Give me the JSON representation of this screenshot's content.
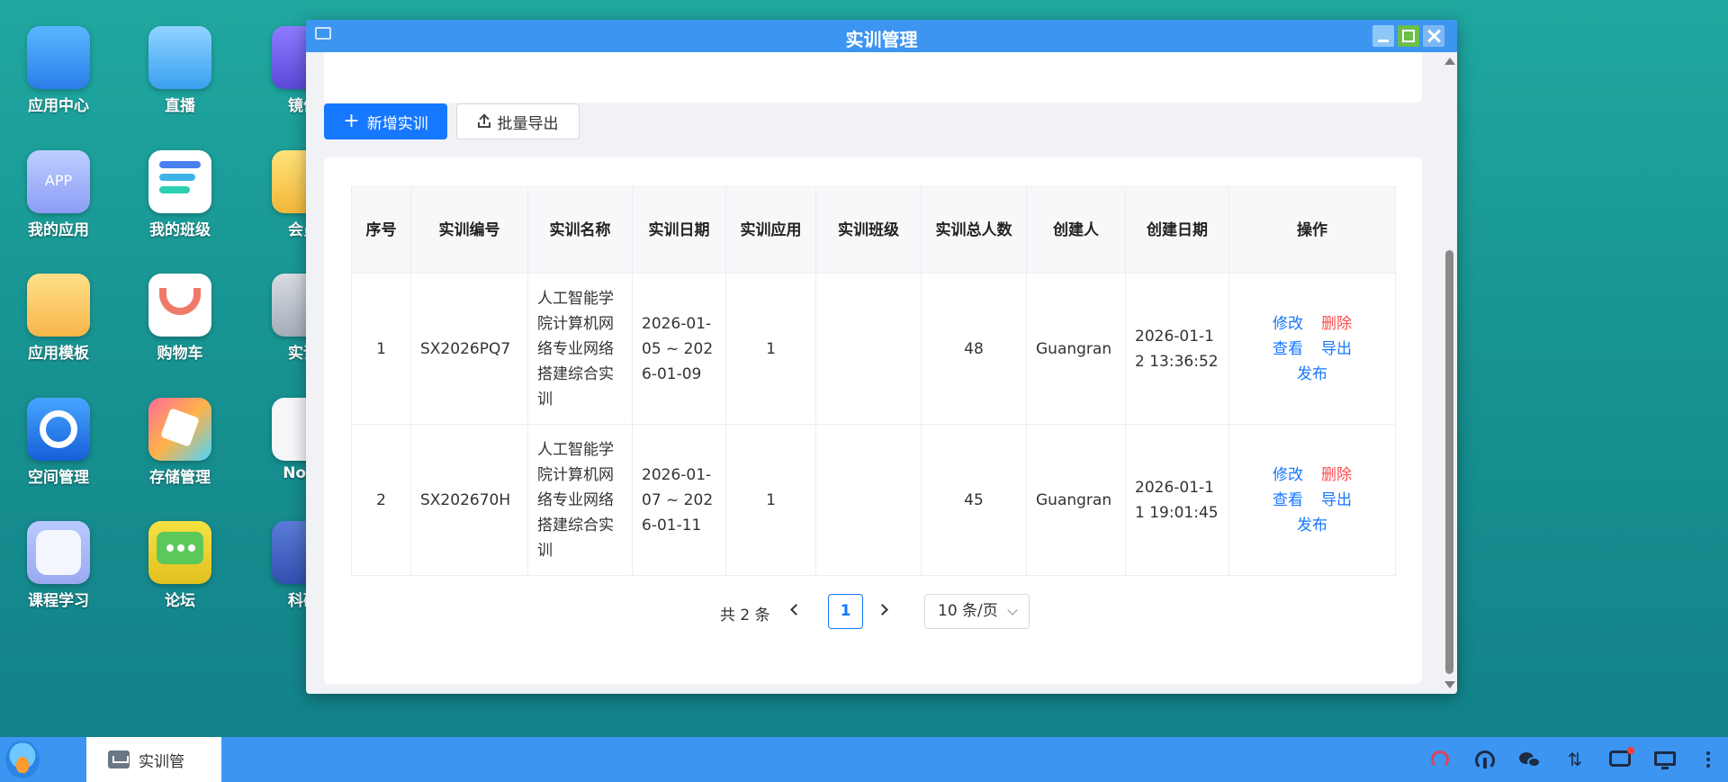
{
  "desktop": {
    "icons": [
      {
        "label": "应用中心",
        "icon": "shopping-bag-icon"
      },
      {
        "label": "直播",
        "icon": "play-icon"
      },
      {
        "label": "镜像",
        "icon": "mirror-icon"
      },
      {
        "label": "我的应用",
        "icon": "app-icon",
        "tile_text": "APP"
      },
      {
        "label": "我的班级",
        "icon": "class-list-icon"
      },
      {
        "label": "会员",
        "icon": "gem-icon"
      },
      {
        "label": "应用模板",
        "icon": "folder-icon"
      },
      {
        "label": "购物车",
        "icon": "cart-icon"
      },
      {
        "label": "实训",
        "icon": "training-icon"
      },
      {
        "label": "空间管理",
        "icon": "globe-icon"
      },
      {
        "label": "存储管理",
        "icon": "storage-icon"
      },
      {
        "label": "Note",
        "icon": "note-icon"
      },
      {
        "label": "课程学习",
        "icon": "course-icon"
      },
      {
        "label": "论坛",
        "icon": "forum-chat-icon"
      },
      {
        "label": "科研",
        "icon": "flask-icon"
      }
    ]
  },
  "window": {
    "title": "实训管理",
    "toolbar": {
      "add_label": "新增实训",
      "add_icon": "+",
      "export_label": "批量导出"
    },
    "table": {
      "headers": [
        "序号",
        "实训编号",
        "实训名称",
        "实训日期",
        "实训应用",
        "实训班级",
        "实训总人数",
        "创建人",
        "创建日期",
        "操作"
      ],
      "rows": [
        {
          "index": "1",
          "code": "SX2026PQ7",
          "name": "人工智能学院计算机网络专业网络搭建综合实训",
          "date": "2026-01-05 ~ 2026-01-09",
          "app": "1",
          "class": "",
          "total": "48",
          "creator": "Guangran",
          "created": "2026-01-12 13:36:52"
        },
        {
          "index": "2",
          "code": "SX202670H",
          "name": "人工智能学院计算机网络专业网络搭建综合实训",
          "date": "2026-01-07 ~ 2026-01-11",
          "app": "1",
          "class": "",
          "total": "45",
          "creator": "Guangran",
          "created": "2026-01-11 19:01:45"
        }
      ],
      "actions": {
        "edit": "修改",
        "delete": "删除",
        "view": "查看",
        "export": "导出",
        "publish": "发布"
      }
    },
    "pagination": {
      "total": "共 2 条",
      "current_page": "1",
      "page_size": "10 条/页"
    }
  },
  "taskbar": {
    "task_label": "实训管"
  },
  "colors": {
    "accent": "#1677ff",
    "danger": "#ff4d4f",
    "titlebar": "#3c95f1",
    "desktop": "#1a9a98"
  }
}
